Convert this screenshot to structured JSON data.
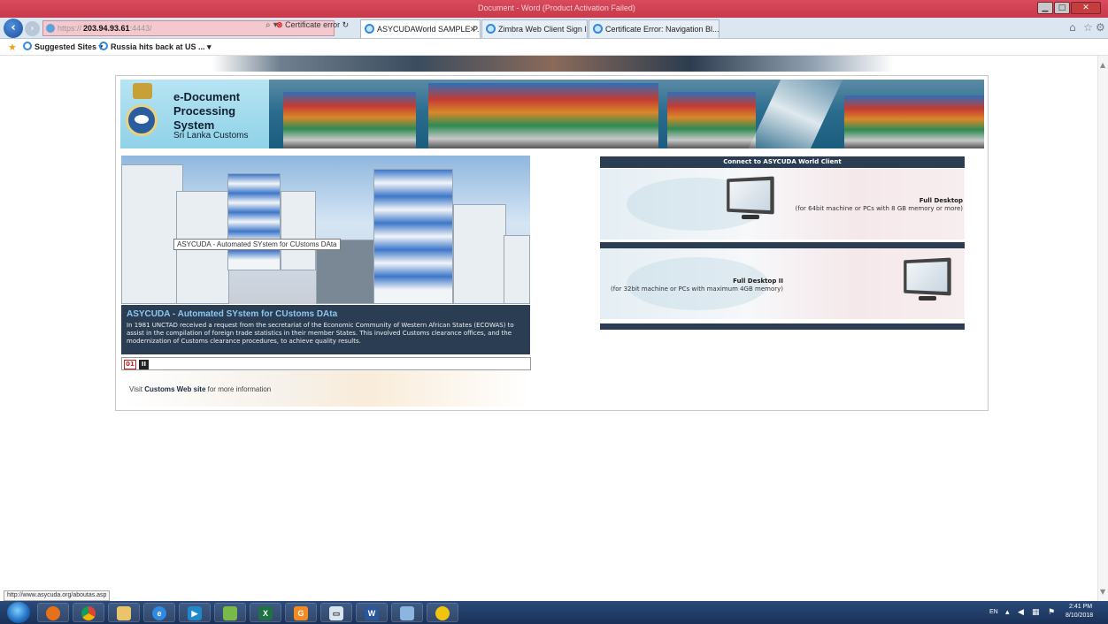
{
  "browser": {
    "window_title": "Document - Word (Product Activation Failed)",
    "address": {
      "protocol": "https://",
      "host": "203.94.93.61",
      "port": ":4443/"
    },
    "certificate_error": "Certificate error",
    "tabs": [
      {
        "label": "ASYCUDAWorld SAMPLE P...",
        "active": true
      },
      {
        "label": "Zimbra Web Client Sign In",
        "active": false
      },
      {
        "label": "Certificate Error: Navigation Bl...",
        "active": false
      }
    ],
    "favorites": {
      "suggested_sites": "Suggested Sites ▾",
      "news_item": "Russia hits back at US ... ▾"
    }
  },
  "banner": {
    "title": "e-Document Processing System",
    "subtitle": "Sri Lanka Customs"
  },
  "slideshow": {
    "tooltip": "ASYCUDA - Automated SYstem for CUstoms DAta",
    "caption_title": "ASYCUDA - Automated SYstem for CUstoms DAta",
    "caption_body": "In 1981 UNCTAD received a request from the secretariat of the Economic Community of Western African States (ECOWAS) to assist in the compilation of foreign trade statistics in their member States. This involved Customs clearance offices, and the modernization of Customs clearance procedures, to achieve quality results.",
    "page_number": "01",
    "pause_symbol": "II"
  },
  "footer_link": {
    "prefix": "Visit ",
    "link_text": "Customs Web site",
    "suffix": " for more information"
  },
  "connect": {
    "header": "Connect to ASYCUDA World Client",
    "options": [
      {
        "title": "Full Desktop",
        "description": "(for 64bit machine or PCs with 8 GB memory or more)"
      },
      {
        "title": "Full Desktop II",
        "description": "(for 32bit machine or PCs with maximum 4GB memory)"
      }
    ]
  },
  "status_bar": {
    "url": "http://www.asycuda.org/aboutas.asp"
  },
  "taskbar": {
    "language": "EN",
    "time": "2:41 PM",
    "date": "8/10/2018",
    "apps": [
      "windows-explorer",
      "firefox",
      "chrome",
      "file-explorer",
      "internet-explorer",
      "media-player",
      "folder",
      "excel",
      "google-app",
      "window",
      "word",
      "network",
      "paint"
    ]
  }
}
